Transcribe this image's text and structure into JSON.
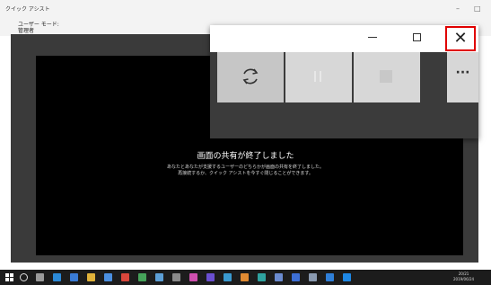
{
  "window": {
    "title": "クイック アシスト",
    "minimize": "–",
    "close": "□"
  },
  "user_bar": {
    "mode_label": "ユーザー モード:",
    "mode_value": "管理者"
  },
  "screen": {
    "message_title": "画面の共有が終了しました",
    "message_line1": "あなたとあなたが支援するユーザーのどちらかが画面の共有を終了しました。",
    "message_line2": "再接続するか、クイック アシストを今すぐ閉じることができます。"
  },
  "float_window": {
    "minimize_glyph": "—",
    "maximize_glyph": "☐",
    "close_glyph": "✕"
  },
  "controls": {
    "refresh": "refresh-icon",
    "pause": "pause-icon",
    "stop": "stop-icon",
    "more_label": "···"
  },
  "taskbar": {
    "icons": [
      {
        "name": "task-view-icon",
        "color": "#9a9a9a"
      },
      {
        "name": "edge-icon",
        "color": "#2b8ad8"
      },
      {
        "name": "store-icon",
        "color": "#3a7bd5"
      },
      {
        "name": "explorer-icon",
        "color": "#e0b23a"
      },
      {
        "name": "mail-icon",
        "color": "#4b8fe0"
      },
      {
        "name": "chrome-icon",
        "color": "#d9473c"
      },
      {
        "name": "app1-icon",
        "color": "#46a35a"
      },
      {
        "name": "app2-icon",
        "color": "#5c9fd6"
      },
      {
        "name": "calculator-icon",
        "color": "#8a8a8a"
      },
      {
        "name": "app3-icon",
        "color": "#cf4fae"
      },
      {
        "name": "app4-icon",
        "color": "#6a4fd0"
      },
      {
        "name": "app5-icon",
        "color": "#3a9ad0"
      },
      {
        "name": "app6-icon",
        "color": "#e08a32"
      },
      {
        "name": "app7-icon",
        "color": "#2fa3a0"
      },
      {
        "name": "app8-icon",
        "color": "#6b8bd0"
      },
      {
        "name": "app9-icon",
        "color": "#3d6fd6"
      },
      {
        "name": "app10-icon",
        "color": "#8a9ab0"
      },
      {
        "name": "app11-icon",
        "color": "#2f7fd8"
      },
      {
        "name": "quick-assist-icon",
        "color": "#1e88e5"
      }
    ],
    "time": "20/21",
    "date": "2019/06/24"
  }
}
